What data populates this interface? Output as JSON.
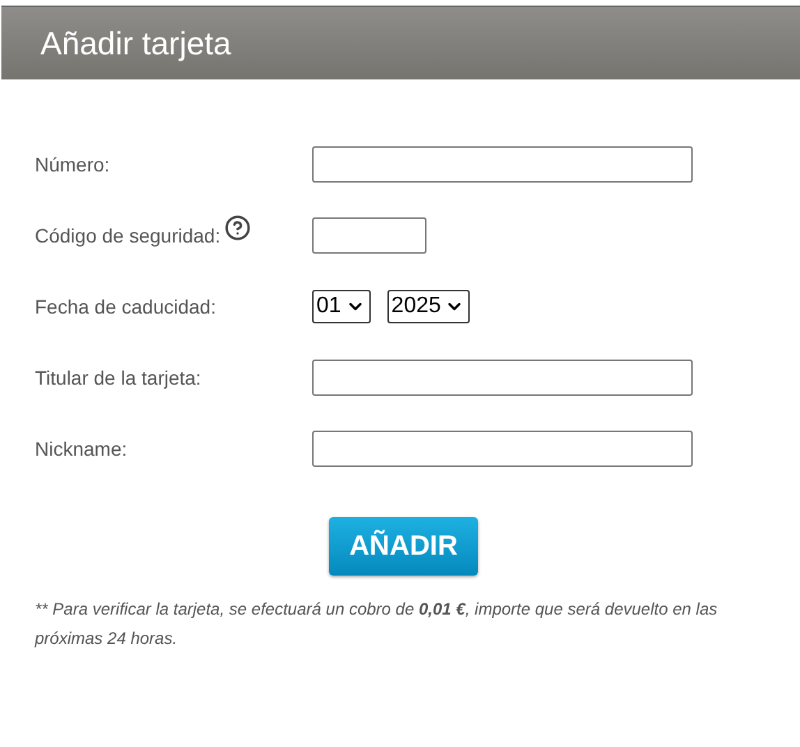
{
  "title": "Añadir tarjeta",
  "fields": [
    {
      "label": "Número:",
      "kind": "text"
    },
    {
      "label": "Código de seguridad:",
      "kind": "short",
      "help": true
    },
    {
      "label": "Fecha de caducidad:",
      "kind": "select",
      "selects": [
        "01",
        "2025"
      ]
    },
    {
      "label": "Titular de la tarjeta:",
      "kind": "text"
    },
    {
      "label": "Nickname:",
      "kind": "text"
    }
  ],
  "submit": "AÑADIR",
  "note": {
    "before": "** Para verificar la tarjeta, se efectuará un cobro de ",
    "amount": "0,01 €",
    "after": ", importe que será devuelto en las próximas 24 horas."
  }
}
